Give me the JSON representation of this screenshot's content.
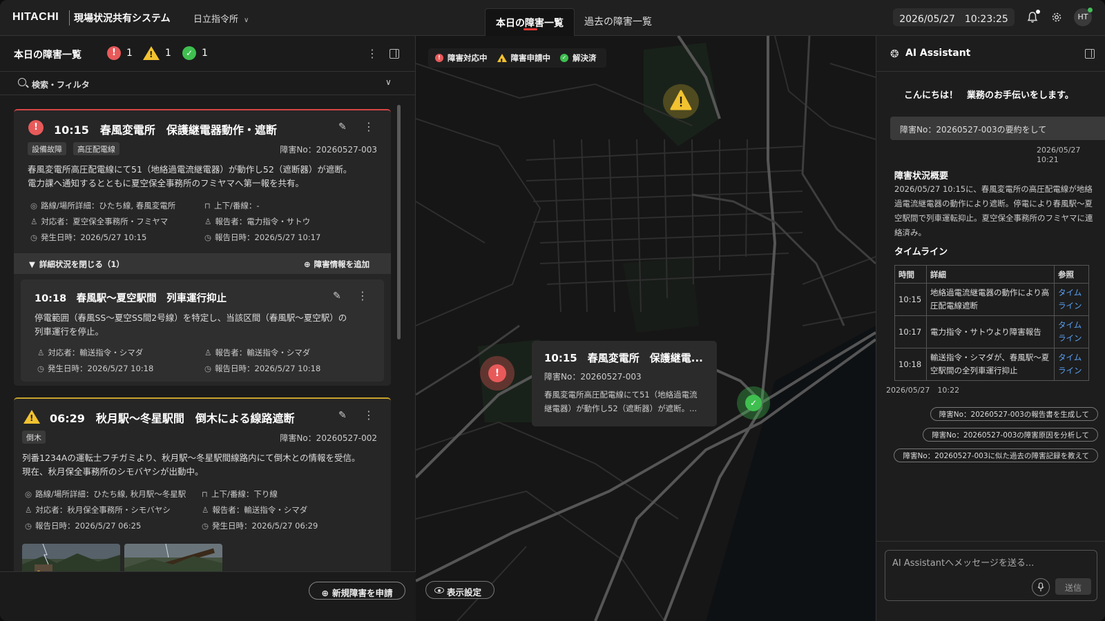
{
  "header": {
    "logo": "HITACHI",
    "system_title": "現場状況共有システム",
    "office": "日立指令所",
    "tab_today": "本日の障害一覧",
    "tab_past": "過去の障害一覧",
    "datetime": "2026/05/27　10:23:25",
    "avatar": "HT"
  },
  "left": {
    "title": "本日の障害一覧",
    "counts": {
      "error": "1",
      "warning": "1",
      "ok": "1"
    },
    "filter_label": "検索・フィルタ",
    "cards": [
      {
        "title": "10:15　春風変電所　保護継電器動作・遮断",
        "tags": [
          "設備故障",
          "高圧配電線"
        ],
        "incident_no": "障害No：20260527-003",
        "desc_line1": "春風変電所高圧配電線にて51（地絡過電流継電器）が動作し52（遮断器）が遮断。",
        "desc_line2": "電力課へ通知するとともに夏空保全事務所のフミヤマへ第一報を共有。",
        "location": "路線/場所詳細：ひたち線, 春風変電所",
        "direction": "上下/番線：-",
        "handler": "対応者：夏空保全事務所・フミヤマ",
        "reporter": "報告者：電力指令・サトウ",
        "occurred": "発生日時：2026/5/27 10:15",
        "reported": "報告日時：2026/5/27 10:17",
        "detail_toggle": "詳細状況を閉じる（1）",
        "detail_add": "障害情報を追加",
        "sub": {
          "title": "10:18　春風駅〜夏空駅間　列車運行抑止",
          "desc_line1": "停電範囲（春風SS〜夏空SS間2号線）を特定し、当該区間（春風駅〜夏空駅）の",
          "desc_line2": "列車運行を停止。",
          "handler": "対応者：輸送指令・シマダ",
          "reporter": "報告者：輸送指令・シマダ",
          "occurred": "発生日時：2026/5/27 10:18",
          "reported": "報告日時：2026/5/27 10:18"
        }
      },
      {
        "title": "06:29　秋月駅〜冬星駅間　倒木による線路遮断",
        "tags": [
          "倒木"
        ],
        "incident_no": "障害No：20260527-002",
        "desc_line1": "列番1234Aの運転士フチガミより、秋月駅〜冬星駅間線路内にて倒木との情報を受信。",
        "desc_line2": "現在、秋月保全事務所のシモバヤシが出動中。",
        "location": "路線/場所詳細：ひたち線, 秋月駅〜冬星駅",
        "direction": "上下/番線：下り線",
        "handler": "対応者：秋月保全事務所・シモバヤシ",
        "reporter": "報告者：輸送指令・シマダ",
        "reported": "報告日時：2026/5/27 06:25",
        "occurred": "発生日時：2026/5/27 06:29"
      }
    ],
    "new_button": "新規障害を申請"
  },
  "map": {
    "legend": {
      "active": "障害対応中",
      "pending": "障害申請中",
      "resolved": "解決済"
    },
    "popup": {
      "title": "10:15　春風変電所　保護継電...",
      "incident_no": "障害No：20260527-003",
      "desc_line1": "春風変電所高圧配電線にて51（地絡過電流",
      "desc_line2": "継電器）が動作し52（遮断器）が遮断。..."
    },
    "display_settings": "表示設定"
  },
  "ai": {
    "title": "AI Assistant",
    "greeting": "こんにちは！　業務のお手伝いをします。",
    "user_message": "障害No：20260527-003の要約をして",
    "user_ts": "2026/05/27　10:21",
    "summary_heading": "障害状況概要",
    "summary_text": "2026/05/27 10:15に、春風変電所の高圧配電線が地絡過電流継電器の動作により遮断。停電により春風駅〜夏空駅間で列車運転抑止。夏空保全事務所のフミヤマに連絡済み。",
    "timeline_heading": "タイムライン",
    "timeline_cols": [
      "時間",
      "詳細",
      "参照"
    ],
    "timeline_rows": [
      {
        "time": "10:15",
        "detail": "地絡過電流継電器の動作により高圧配電線遮断",
        "ref": "タイムライン"
      },
      {
        "time": "10:17",
        "detail": "電力指令・サトウより障害報告",
        "ref": "タイムライン"
      },
      {
        "time": "10:18",
        "detail": "輸送指令・シマダが、春風駅〜夏空駅間の全列車運行抑止",
        "ref": "タイムライン"
      }
    ],
    "reply_ts": "2026/05/27　10:22",
    "suggestions": [
      "障害No：20260527-003の報告書を生成して",
      "障害No：20260527-003の障害原因を分析して",
      "障害No：20260527-003に似た過去の障害記録を教えて"
    ],
    "input_placeholder": "AI Assistantへメッセージを送る...",
    "send_label": "送信"
  },
  "colors": {
    "error": "#e85a5a",
    "warning": "#f2c230",
    "ok": "#3fbf4f",
    "link": "#5aa2f5",
    "tab_accent": "#e53935"
  }
}
